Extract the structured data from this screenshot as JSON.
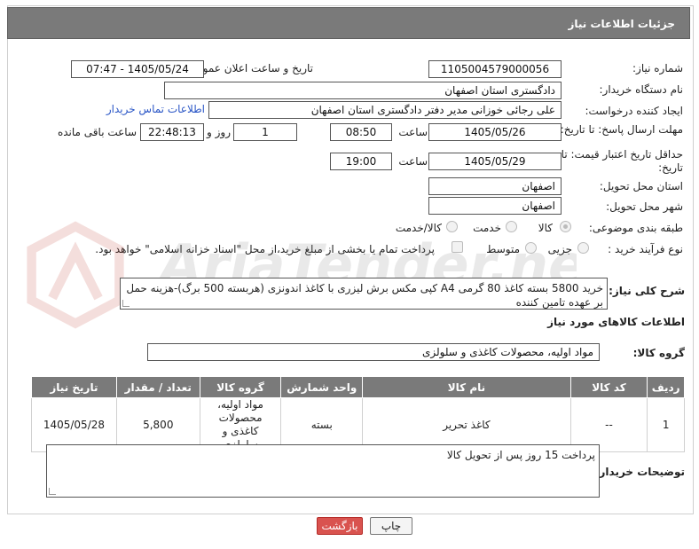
{
  "header": {
    "title": "جزئیات اطلاعات نیاز"
  },
  "form": {
    "need_number_label": "شماره نیاز:",
    "need_number": "1105004579000056",
    "announce_label": "تاریخ و ساعت اعلان عمومی:",
    "announce_value": "1405/05/24 - 07:47",
    "buyer_org_label": "نام دستگاه خریدار:",
    "buyer_org": "دادگستری استان اصفهان",
    "creator_label": "ایجاد کننده درخواست:",
    "creator": "علی رجائی خوزانی مدیر دفتر دادگستری استان اصفهان",
    "contact_link": "اطلاعات تماس خریدار",
    "deadline_label": "مهلت ارسال پاسخ: تا تاریخ:",
    "deadline_date": "1405/05/26",
    "time_label": "ساعت",
    "deadline_time": "08:50",
    "days_value": "1",
    "days_label": "روز و",
    "remaining_time": "22:48:13",
    "remaining_label": "ساعت باقی مانده",
    "validity_label": "حداقل تاریخ اعتبار قیمت: تا تاریخ:",
    "validity_date": "1405/05/29",
    "validity_time_label": "ساعت",
    "validity_time": "19:00",
    "province_label": "استان محل تحویل:",
    "province": "اصفهان",
    "city_label": "شهر محل تحویل:",
    "city": "اصفهان",
    "category_label": "طبقه بندی موضوعی:",
    "category_options": [
      "کالا",
      "خدمت",
      "کالا/خدمت"
    ],
    "process_label": "نوع فرآیند خرید :",
    "process_options": [
      "جزیی",
      "متوسط"
    ],
    "payment_note": "پرداخت تمام یا بخشی از مبلغ خرید،از محل \"اسناد خزانه اسلامی\" خواهد بود.",
    "description_label": "شرح کلی نیاز:",
    "description": "خرید 5800 بسته کاغذ 80 گرمی A4 کپی مکس برش لیزری با کاغذ اندونزی (هربسته 500 برگ)-هزینه حمل بر عهده تامین کننده"
  },
  "goods": {
    "section_title": "اطلاعات کالاهای مورد نیاز",
    "group_label": "گروه کالا:",
    "group_value": "مواد اولیه، محصولات کاغذی و سلولزی",
    "columns": [
      "ردیف",
      "کد کالا",
      "نام کالا",
      "واحد شمارش",
      "گروه کالا",
      "تعداد / مقدار",
      "تاریخ نیاز"
    ],
    "rows": [
      {
        "index": "1",
        "code": "--",
        "name": "کاغذ تحریر",
        "unit": "بسته",
        "group": "مواد اولیه، محصولات کاغذی و سلولزی",
        "qty": "5,800",
        "date": "1405/05/28"
      }
    ]
  },
  "buyer_notes": {
    "label": "توضیحات خریدار:",
    "text": "پرداخت 15 روز پس از تحویل کالا"
  },
  "buttons": {
    "print": "چاپ",
    "back": "بازگشت"
  },
  "watermark": {
    "text": "AriaTender.neT"
  },
  "colors": {
    "header_bg": "#7a7a7a",
    "link": "#2a56c6",
    "back_button": "#d9534f"
  }
}
